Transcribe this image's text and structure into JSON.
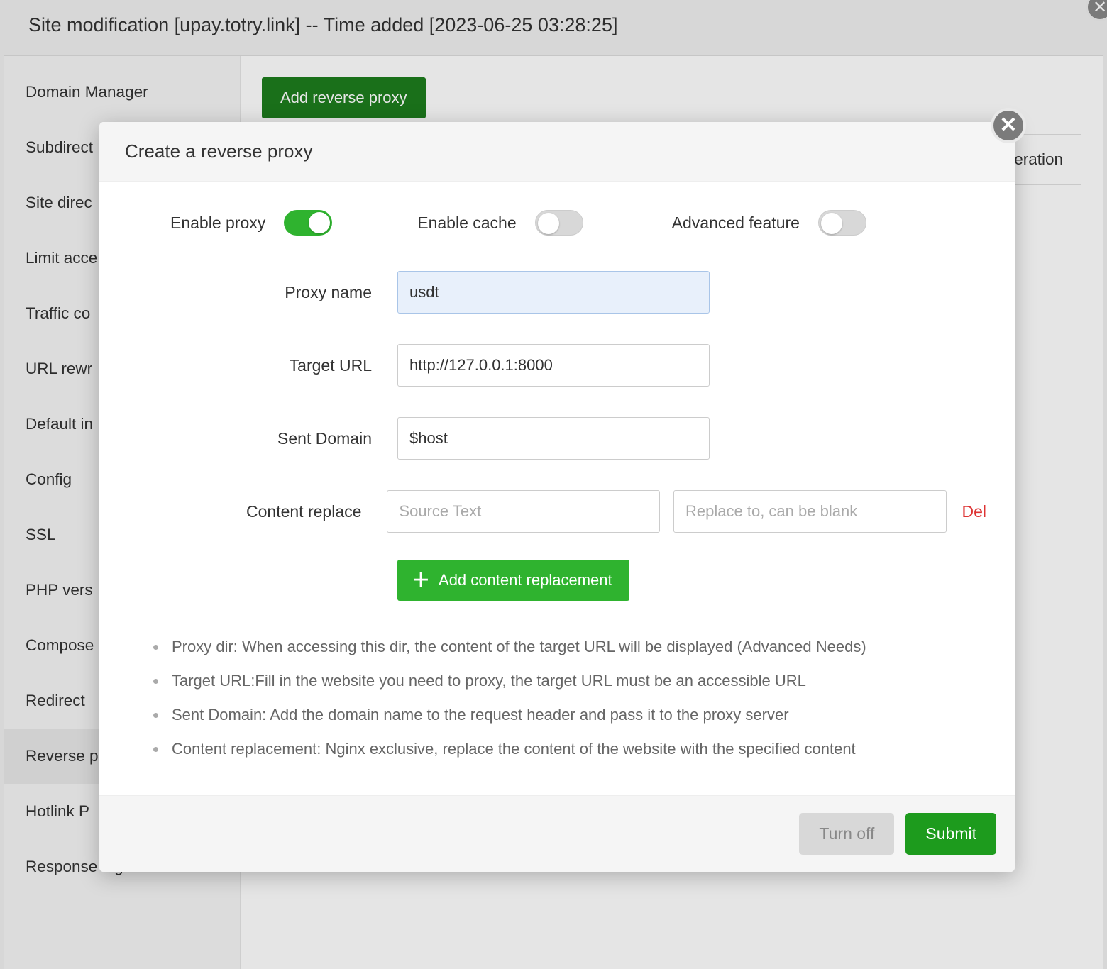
{
  "header": {
    "title": "Site modification [upay.totry.link] -- Time added [2023-06-25 03:28:25]"
  },
  "sidebar": {
    "items": [
      "Domain Manager",
      "Subdirect",
      "Site direc",
      "Limit acce",
      "Traffic co",
      "URL rewr",
      "Default in",
      "Config",
      "SSL",
      "PHP vers",
      "Compose",
      "Redirect",
      "Reverse p",
      "Hotlink P",
      "Response log"
    ],
    "active_index": 12
  },
  "bg_main": {
    "add_button": "Add reverse proxy",
    "table_header_last": "eration"
  },
  "modal": {
    "title": "Create a reverse proxy",
    "toggles": {
      "enable_proxy": {
        "label": "Enable proxy",
        "on": true
      },
      "enable_cache": {
        "label": "Enable cache",
        "on": false
      },
      "advanced": {
        "label": "Advanced feature",
        "on": false
      }
    },
    "form": {
      "proxy_name": {
        "label": "Proxy name",
        "value": "usdt"
      },
      "target_url": {
        "label": "Target URL",
        "value": "http://127.0.0.1:8000"
      },
      "sent_domain": {
        "label": "Sent Domain",
        "value": "$host"
      },
      "content_replace": {
        "label": "Content replace",
        "source_placeholder": "Source Text",
        "replace_placeholder": "Replace to, can be blank",
        "del": "Del"
      },
      "add_cr_button": "Add content replacement"
    },
    "help": [
      "Proxy dir: When accessing this dir, the content of the target URL will be displayed (Advanced Needs)",
      "Target URL:Fill in the website you need to proxy, the target URL must be an accessible URL",
      "Sent Domain: Add the domain name to the request header and pass it to the proxy server",
      "Content replacement: Nginx exclusive, replace the content of the website with the specified content"
    ],
    "footer": {
      "turn_off": "Turn off",
      "submit": "Submit"
    }
  }
}
